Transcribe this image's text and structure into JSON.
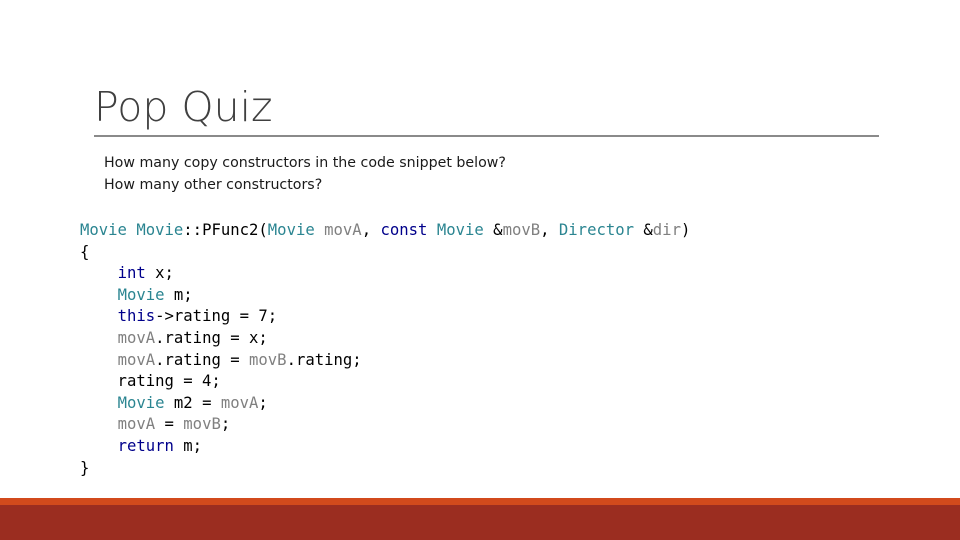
{
  "slide": {
    "title": "Pop Quiz",
    "questions": [
      "How many copy constructors in the code snippet below?",
      "How many other constructors?"
    ],
    "colors": {
      "type": "#2b8591",
      "keyword": "#00008b",
      "parameter": "#808080",
      "plain": "#000000",
      "footer_stripe": "#d24a1c",
      "footer_band": "#9b2d20"
    },
    "code_lines": [
      [
        {
          "t": "Movie",
          "k": "type"
        },
        {
          "t": " ",
          "k": "plain"
        },
        {
          "t": "Movie",
          "k": "type"
        },
        {
          "t": "::PFunc2(",
          "k": "plain"
        },
        {
          "t": "Movie",
          "k": "type"
        },
        {
          "t": " ",
          "k": "plain"
        },
        {
          "t": "movA",
          "k": "param"
        },
        {
          "t": ", ",
          "k": "plain"
        },
        {
          "t": "const",
          "k": "kw"
        },
        {
          "t": " ",
          "k": "plain"
        },
        {
          "t": "Movie",
          "k": "type"
        },
        {
          "t": " &",
          "k": "plain"
        },
        {
          "t": "movB",
          "k": "param"
        },
        {
          "t": ", ",
          "k": "plain"
        },
        {
          "t": "Director",
          "k": "type"
        },
        {
          "t": " &",
          "k": "plain"
        },
        {
          "t": "dir",
          "k": "param"
        },
        {
          "t": ")",
          "k": "plain"
        }
      ],
      [
        {
          "t": "{",
          "k": "plain"
        }
      ],
      [
        {
          "t": "    ",
          "k": "plain"
        },
        {
          "t": "int",
          "k": "kw"
        },
        {
          "t": " x;",
          "k": "plain"
        }
      ],
      [
        {
          "t": "    ",
          "k": "plain"
        },
        {
          "t": "Movie",
          "k": "type"
        },
        {
          "t": " m;",
          "k": "plain"
        }
      ],
      [
        {
          "t": "    ",
          "k": "plain"
        },
        {
          "t": "this",
          "k": "kw"
        },
        {
          "t": "->rating = 7;",
          "k": "plain"
        }
      ],
      [
        {
          "t": "    ",
          "k": "plain"
        },
        {
          "t": "movA",
          "k": "param"
        },
        {
          "t": ".rating = x;",
          "k": "plain"
        }
      ],
      [
        {
          "t": "    ",
          "k": "plain"
        },
        {
          "t": "movA",
          "k": "param"
        },
        {
          "t": ".rating = ",
          "k": "plain"
        },
        {
          "t": "movB",
          "k": "param"
        },
        {
          "t": ".rating;",
          "k": "plain"
        }
      ],
      [
        {
          "t": "    rating = 4;",
          "k": "plain"
        }
      ],
      [
        {
          "t": "    ",
          "k": "plain"
        },
        {
          "t": "Movie",
          "k": "type"
        },
        {
          "t": " m2 = ",
          "k": "plain"
        },
        {
          "t": "movA",
          "k": "param"
        },
        {
          "t": ";",
          "k": "plain"
        }
      ],
      [
        {
          "t": "    ",
          "k": "plain"
        },
        {
          "t": "movA",
          "k": "param"
        },
        {
          "t": " = ",
          "k": "plain"
        },
        {
          "t": "movB",
          "k": "param"
        },
        {
          "t": ";",
          "k": "plain"
        }
      ],
      [
        {
          "t": "    ",
          "k": "plain"
        },
        {
          "t": "return",
          "k": "kw"
        },
        {
          "t": " m;",
          "k": "plain"
        }
      ],
      [
        {
          "t": "}",
          "k": "plain"
        }
      ]
    ]
  }
}
